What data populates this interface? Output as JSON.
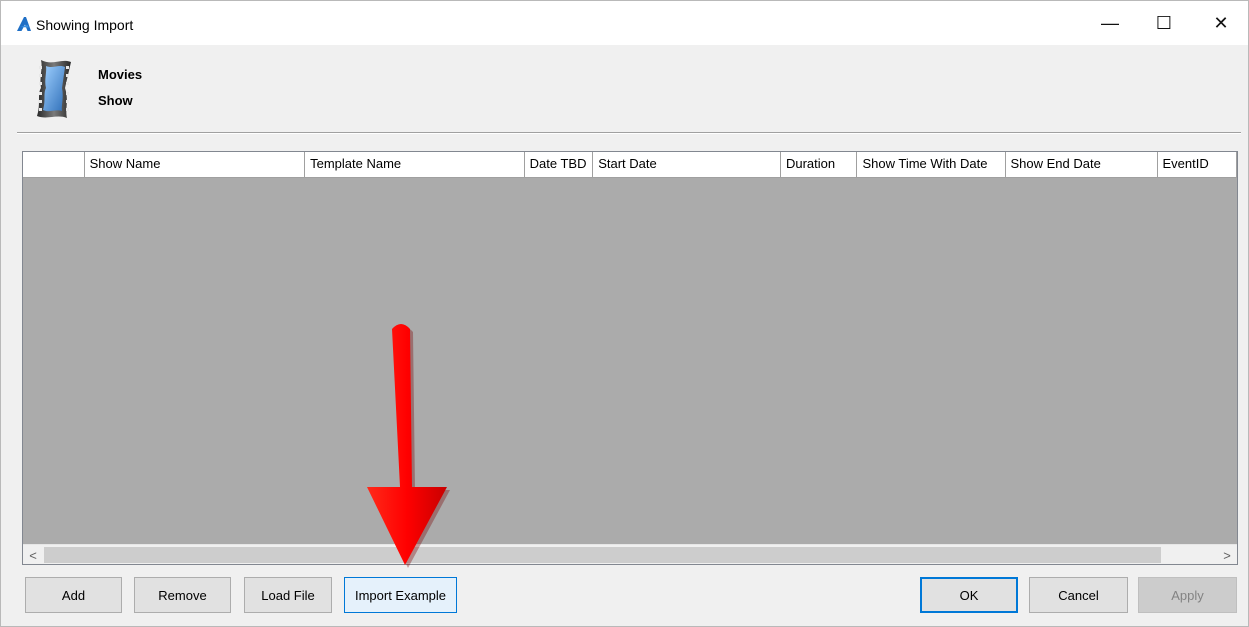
{
  "window": {
    "title": "Showing Import",
    "controls": {
      "minimize": "—",
      "maximize": "☐",
      "close": "✕"
    }
  },
  "header": {
    "title": "Movies",
    "subtitle": "Show"
  },
  "grid": {
    "columns": [
      "",
      "Show Name",
      "Template Name",
      "Date TBD",
      "Start Date",
      "Duration",
      "Show Time With Date",
      "Show End Date",
      "EventID"
    ],
    "rows": []
  },
  "buttons": {
    "add": "Add",
    "remove": "Remove",
    "load_file": "Load File",
    "import_example": "Import Example",
    "ok": "OK",
    "cancel": "Cancel",
    "apply": "Apply"
  },
  "colors": {
    "accent": "#0078d7",
    "grid_background": "#ababab",
    "annotation_arrow": "#e00000"
  }
}
